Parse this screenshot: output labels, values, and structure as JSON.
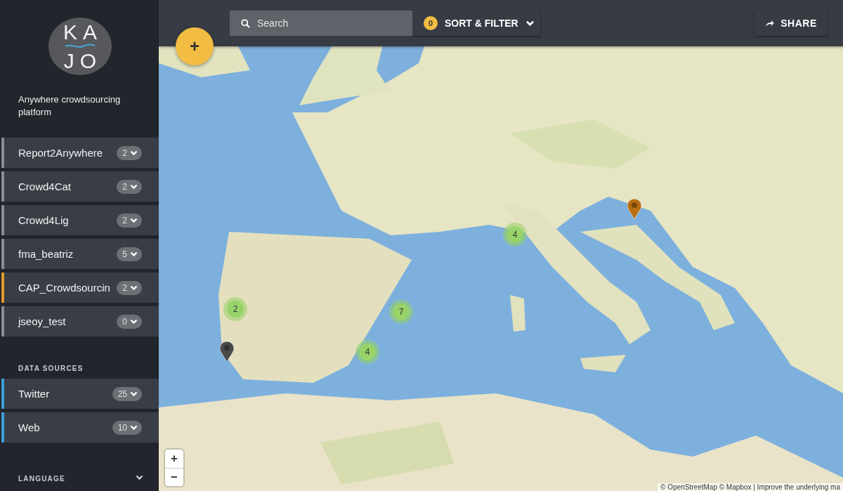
{
  "logo": {
    "line_1": "KA",
    "line_2": "JO"
  },
  "tagline": "Anywhere crowdsourcing platform",
  "projects": [
    {
      "name": "Report2Anywhere",
      "count": "2",
      "color": "#8a8d92"
    },
    {
      "name": "Crowd4Cat",
      "count": "2",
      "color": "#8a8d92"
    },
    {
      "name": "Crowd4Lig",
      "count": "2",
      "color": "#8a8d92"
    },
    {
      "name": "fma_beatriz",
      "count": "5",
      "color": "#8a8d92"
    },
    {
      "name": "CAP_Crowdsourcin",
      "count": "2",
      "color": "#e39a2d"
    },
    {
      "name": "jseoy_test",
      "count": "0",
      "color": "#8a8d92"
    }
  ],
  "data_sources": {
    "heading": "DATA SOURCES",
    "items": [
      {
        "name": "Twitter",
        "count": "25",
        "color": "#3d9fdc"
      },
      {
        "name": "Web",
        "count": "10",
        "color": "#3d9fdc"
      }
    ]
  },
  "language": {
    "heading": "LANGUAGE",
    "expanded": false
  },
  "toolbar": {
    "search": {
      "placeholder": "Search"
    },
    "filter_count": "0",
    "filter_label": "SORT & FILTER",
    "share_label": "SHARE",
    "add_label": "+"
  },
  "map": {
    "kind": "picture",
    "markers": [
      {
        "kind": "cluster",
        "count": "4"
      },
      {
        "kind": "cluster",
        "count": "2"
      },
      {
        "kind": "cluster",
        "count": "7"
      },
      {
        "kind": "cluster",
        "count": "4"
      },
      {
        "kind": "pin",
        "color": "#4a4a4a"
      },
      {
        "kind": "pin",
        "color": "#b86e12"
      }
    ],
    "zoom_in": "+",
    "zoom_out": "−",
    "attribution": "© OpenStreetMap © Mapbox | Improve the underlying ma"
  }
}
